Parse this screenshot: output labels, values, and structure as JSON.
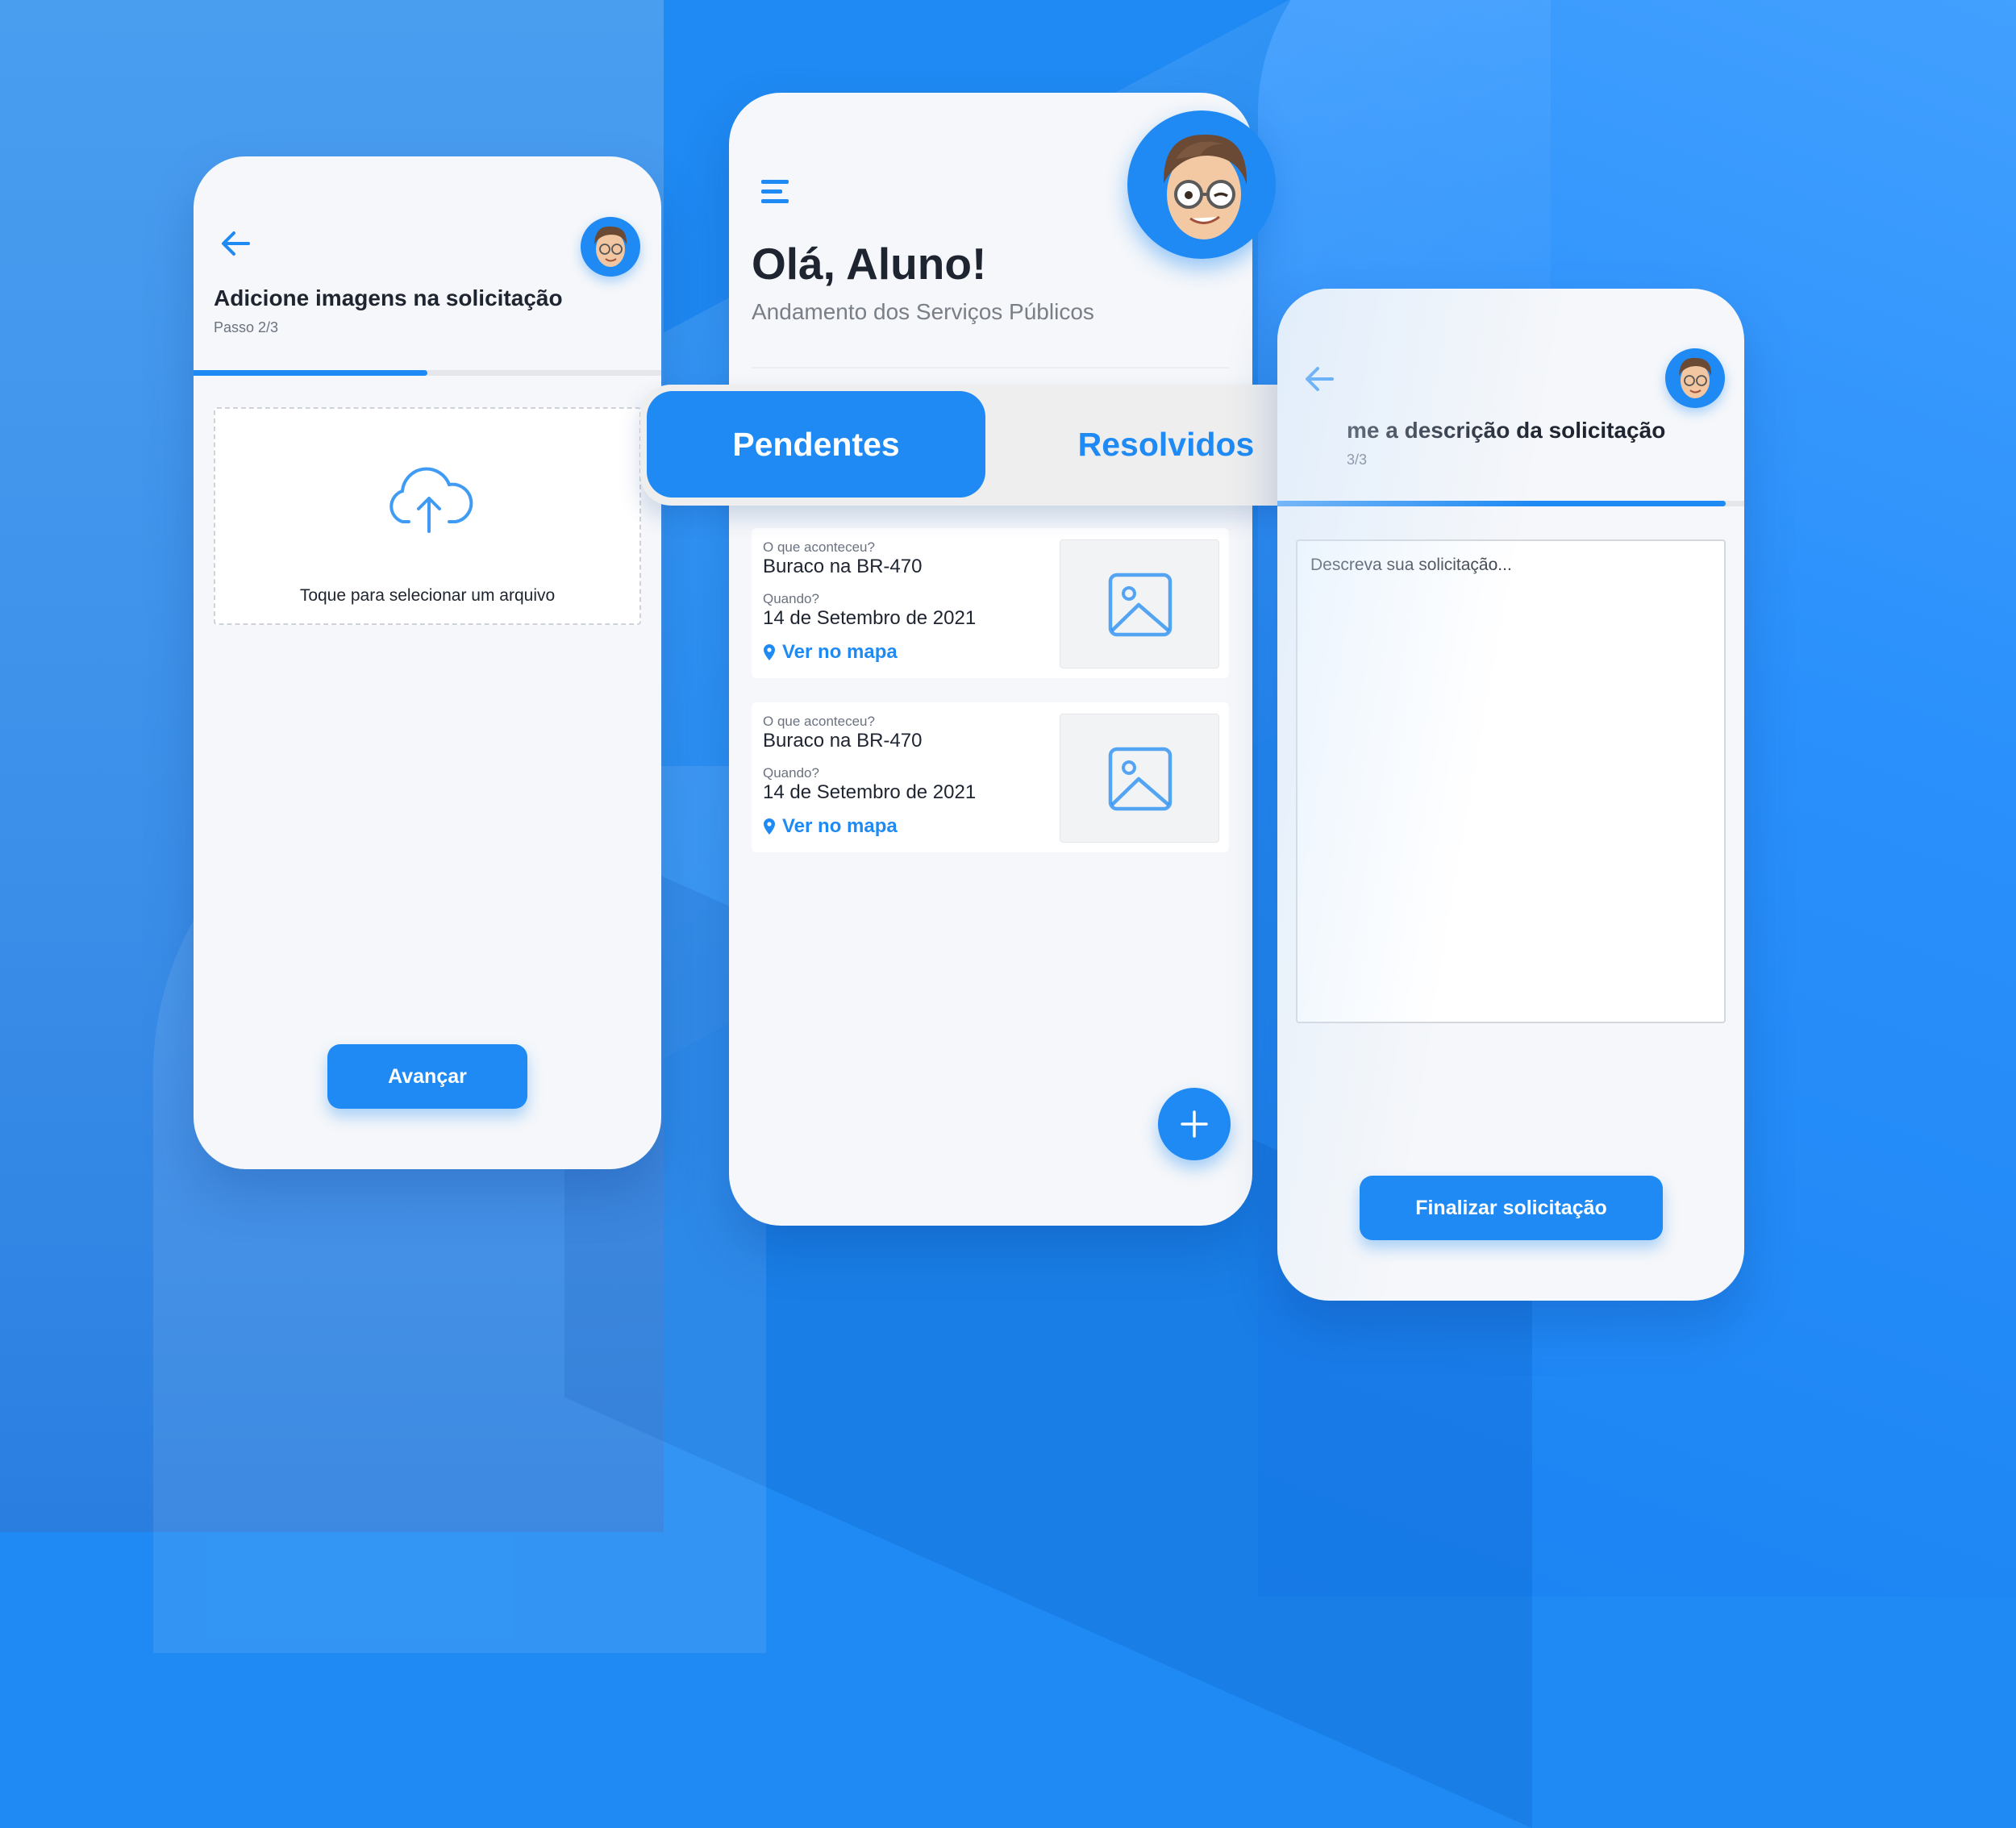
{
  "colors": {
    "accent": "#1f8af3",
    "background": "#1f8af3",
    "card": "#f5f7fa",
    "text": "#1e2430"
  },
  "left_screen": {
    "title": "Adicione imagens na solicitação",
    "step": "Passo 2/3",
    "progress": 0.5,
    "upload_icon": "cloud-upload-icon",
    "upload_text": "Toque para selecionar um arquivo",
    "next_button": "Avançar"
  },
  "center_screen": {
    "greeting": "Olá, Aluno!",
    "subtitle": "Andamento dos Serviços Públicos",
    "tabs": [
      {
        "label": "Pendentes",
        "active": true
      },
      {
        "label": "Resolvidos",
        "active": false
      }
    ],
    "cards": [
      {
        "question": "O que aconteceu?",
        "title": "Buraco na BR-470",
        "when_label": "Quando?",
        "date": "14 de Setembro de 2021",
        "link": "Ver no mapa",
        "thumb_icon": "image-placeholder-icon"
      },
      {
        "question": "O que aconteceu?",
        "title": "Buraco na BR-470",
        "when_label": "Quando?",
        "date": "14 de Setembro de 2021",
        "link": "Ver no mapa",
        "thumb_icon": "image-placeholder-icon"
      }
    ],
    "fab_icon": "plus-icon"
  },
  "right_screen": {
    "title": "me a descrição da solicitação",
    "step": "3/3",
    "progress": 1.0,
    "textarea_placeholder": "Descreva sua solicitação...",
    "finish_button": "Finalizar solicitação"
  }
}
